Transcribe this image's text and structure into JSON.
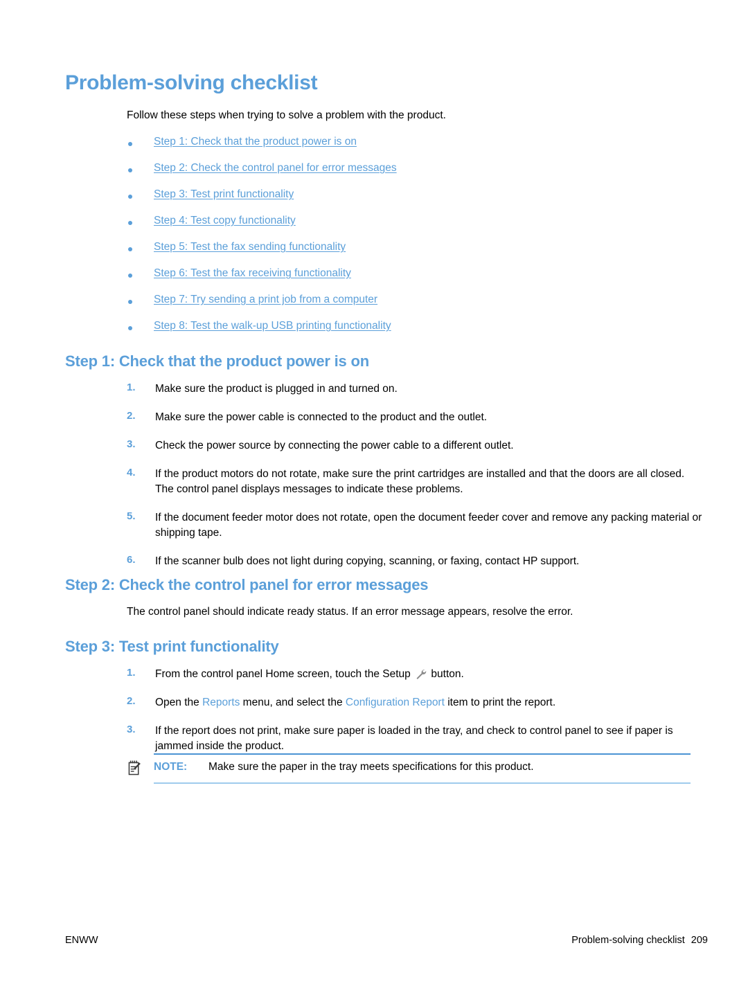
{
  "page": {
    "title": "Problem-solving checklist",
    "intro": "Follow these steps when trying to solve a problem with the product."
  },
  "toc_links": [
    {
      "label": "Step 1: Check that the product power is on"
    },
    {
      "label": "Step 2: Check the control panel for error messages"
    },
    {
      "label": "Step 3: Test print functionality"
    },
    {
      "label": "Step 4: Test copy functionality"
    },
    {
      "label": "Step 5: Test the fax sending functionality"
    },
    {
      "label": "Step 6: Test the fax receiving functionality"
    },
    {
      "label": "Step 7: Try sending a print job from a computer"
    },
    {
      "label": "Step 8: Test the walk-up USB printing functionality"
    }
  ],
  "step1": {
    "heading": "Step 1: Check that the product power is on",
    "items": [
      {
        "marker": "1.",
        "text": "Make sure the product is plugged in and turned on."
      },
      {
        "marker": "2.",
        "text": "Make sure the power cable is connected to the product and the outlet."
      },
      {
        "marker": "3.",
        "text": "Check the power source by connecting the power cable to a different outlet."
      },
      {
        "marker": "4.",
        "text": "If the product motors do not rotate, make sure the print cartridges are installed and that the doors are all closed. The control panel displays messages to indicate these problems."
      },
      {
        "marker": "5.",
        "text": "If the document feeder motor does not rotate, open the document feeder cover and remove any packing material or shipping tape."
      },
      {
        "marker": "6.",
        "text": "If the scanner bulb does not light during copying, scanning, or faxing, contact HP support."
      }
    ]
  },
  "step2": {
    "heading": "Step 2: Check the control panel for error messages",
    "paragraph": "The control panel should indicate ready status. If an error message appears, resolve the error."
  },
  "step3": {
    "heading": "Step 3: Test print functionality",
    "item1": {
      "marker": "1.",
      "text_before_icon": "From the control panel Home screen, touch the Setup",
      "icon": "wrench-icon",
      "text_after_icon": "button."
    },
    "item2": {
      "marker": "2.",
      "part1": "Open the ",
      "term1": "Reports",
      "part2": " menu, and select the ",
      "term2": "Configuration Report",
      "part3": " item to print the report."
    },
    "item3": {
      "marker": "3.",
      "text": "If the report does not print, make sure paper is loaded in the tray, and check to control panel to see if paper is jammed inside the product."
    }
  },
  "note": {
    "icon": "note-pencil-icon",
    "label": "NOTE:",
    "text": "Make sure the paper in the tray meets specifications for this product."
  },
  "footer": {
    "left": "ENWW",
    "section": "Problem-solving checklist",
    "page_number": "209"
  },
  "colors": {
    "heading_blue": "#5B9FD9",
    "link_blue": "#5B9FD9",
    "rule_blue_strong": "#4A93D4",
    "rule_blue_light": "#9FCBEC",
    "body_black": "#000000"
  }
}
